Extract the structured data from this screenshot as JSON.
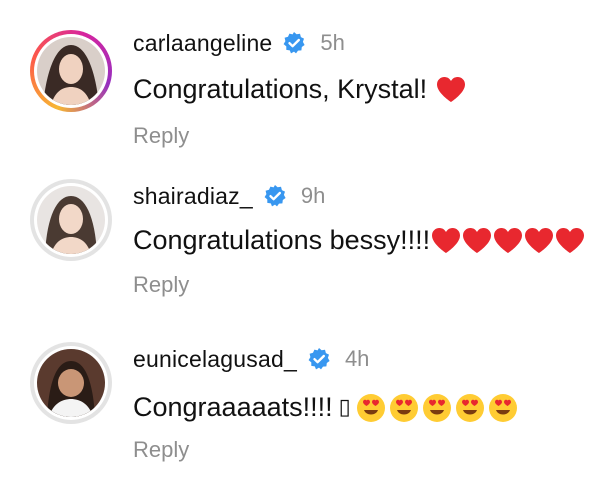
{
  "comments": [
    {
      "username": "carlaangeline",
      "time": "5h",
      "text": "Congratulations, Krystal!",
      "reply_label": "Reply",
      "hearts": 1,
      "ring": "gradient"
    },
    {
      "username": "shairadiaz_",
      "time": "9h",
      "text": "Congratulations bessy!!!!",
      "reply_label": "Reply",
      "hearts": 5,
      "ring": "plain"
    },
    {
      "username": "eunicelagusad_",
      "time": "4h",
      "text": "Congraaaaats!!!!",
      "extra_glyph": "▯",
      "reply_label": "Reply",
      "heart_eyes": 5,
      "ring": "plain"
    }
  ],
  "colors": {
    "verified": "#3897f0",
    "heart": "#e8282f",
    "muted": "#8e8e8e"
  },
  "icons": {
    "verified": "verified-badge-icon",
    "heart": "red-heart-emoji",
    "heart_eyes": "heart-eyes-emoji"
  }
}
